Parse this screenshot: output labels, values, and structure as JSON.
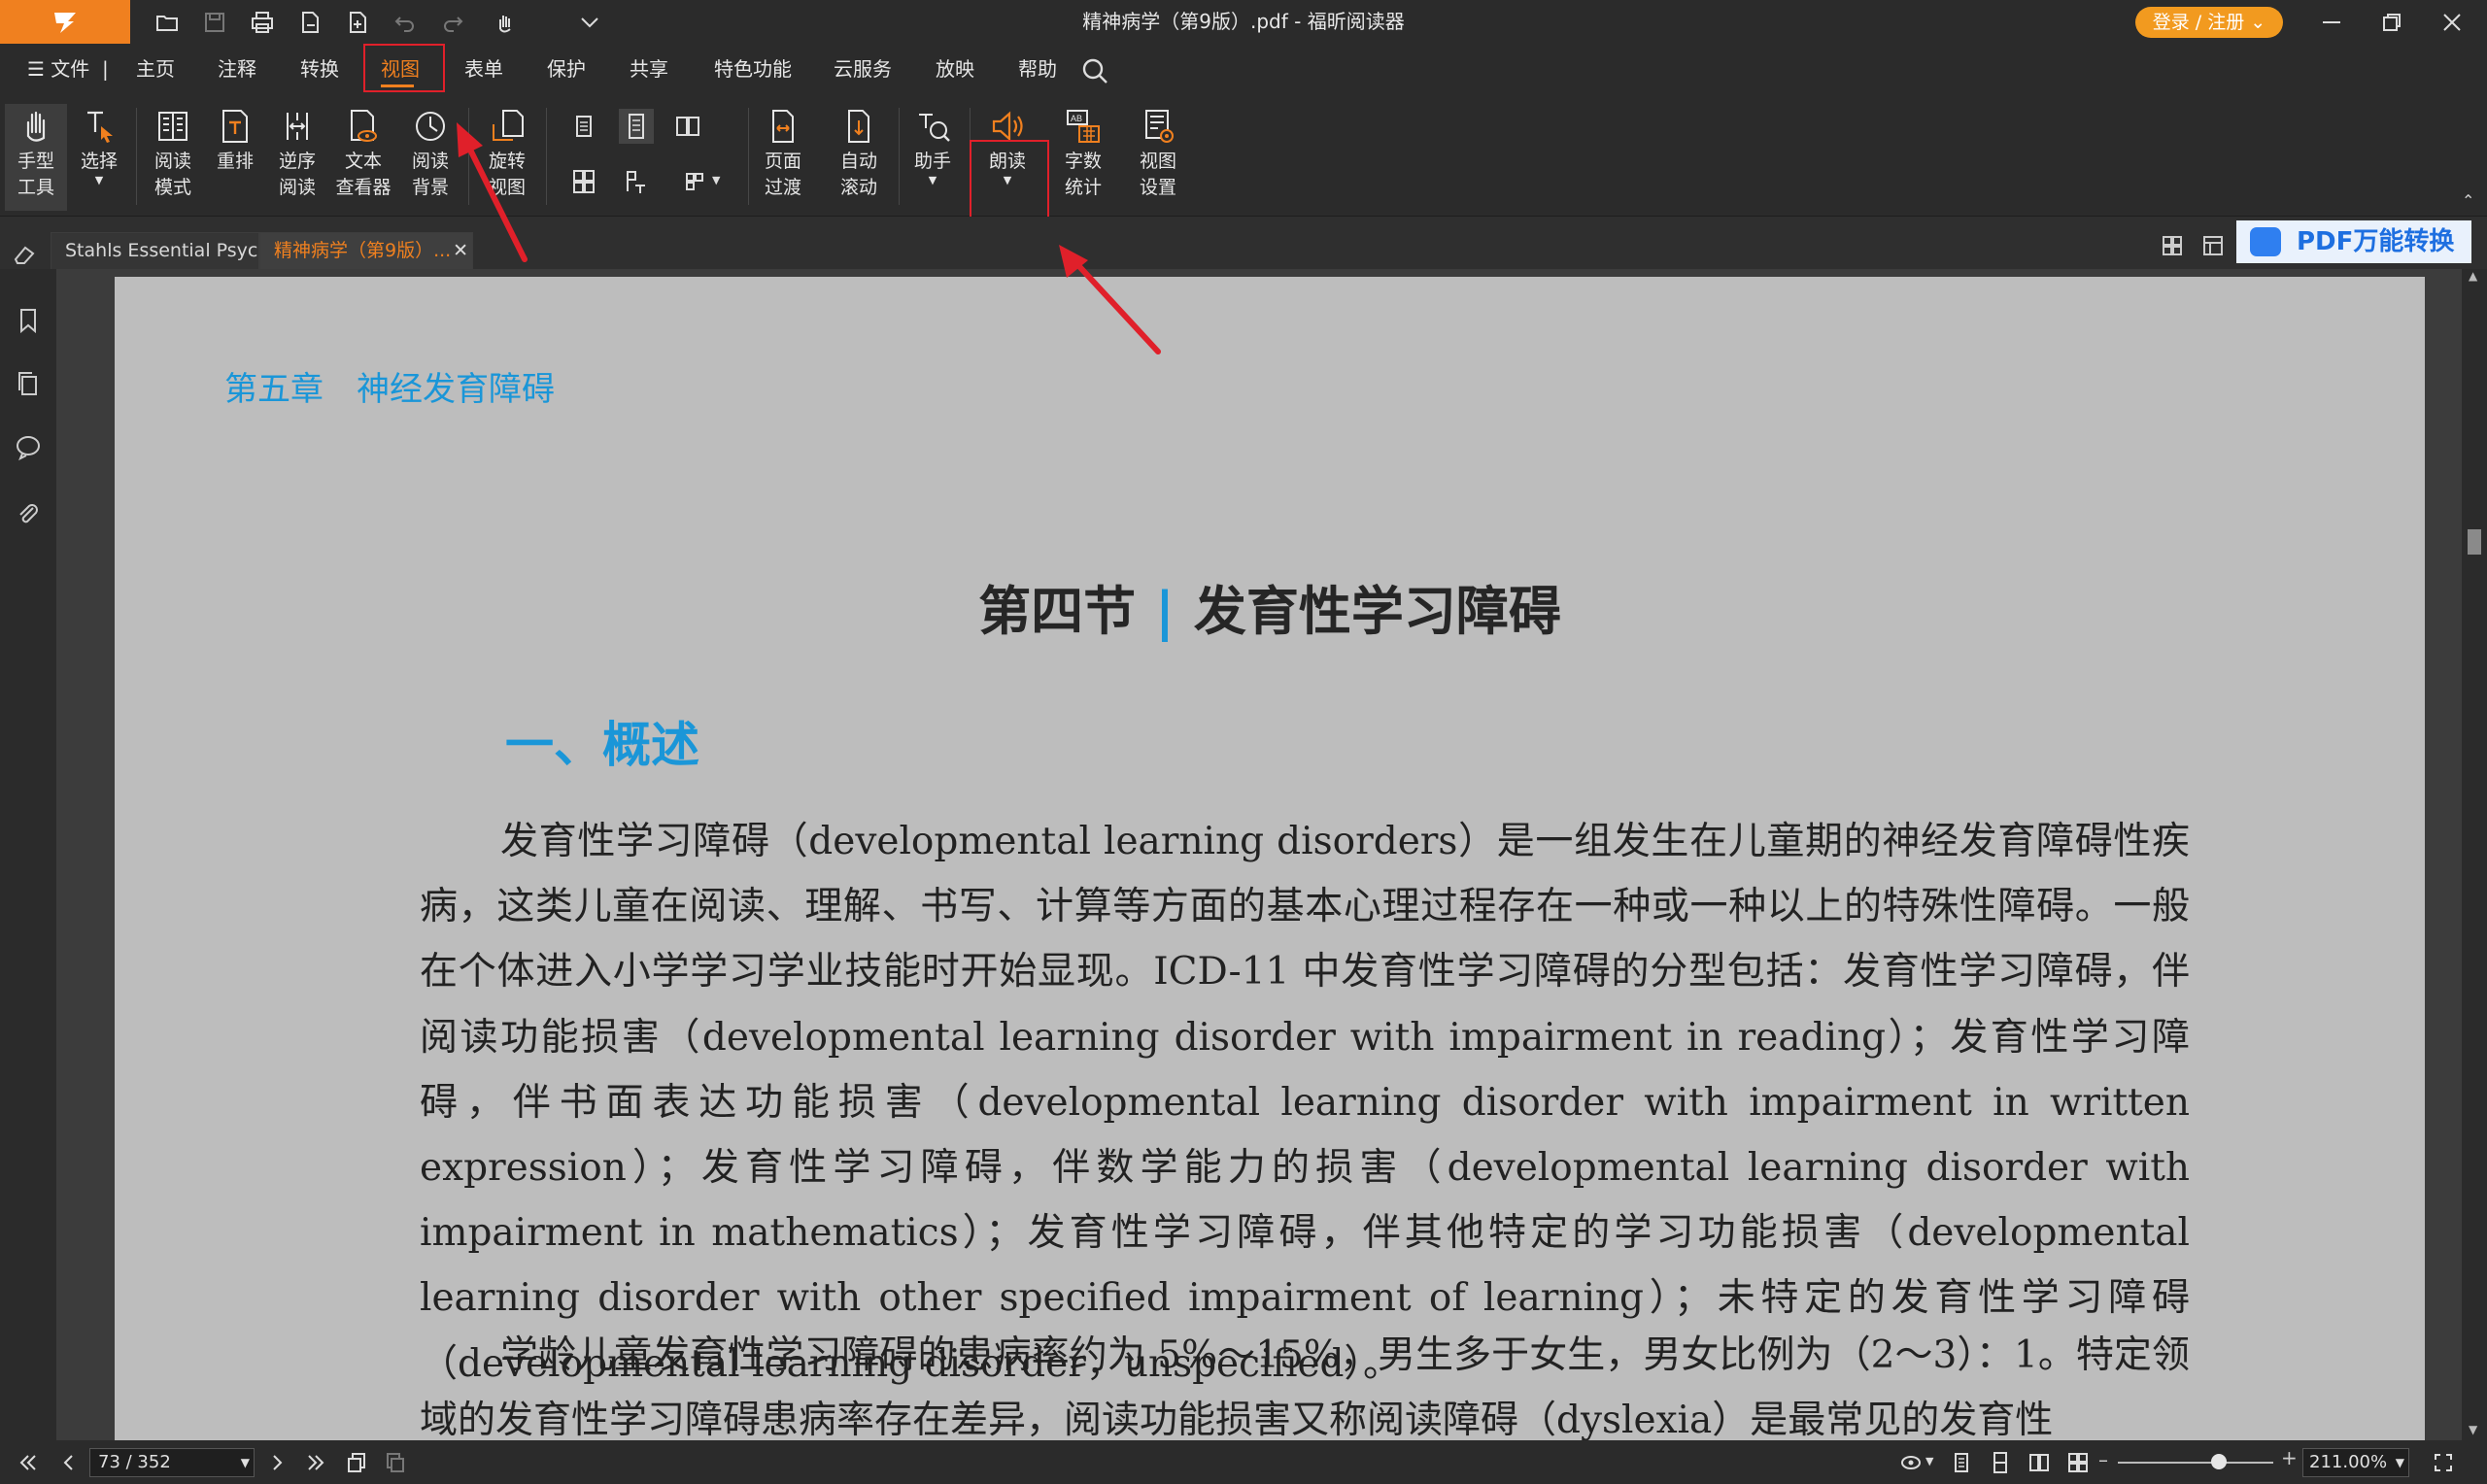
{
  "window": {
    "title": "精神病学（第9版）.pdf - 福昕阅读器",
    "login_label": "登录 / 注册"
  },
  "menu": {
    "file": "文件",
    "tabs": [
      "主页",
      "注释",
      "转换",
      "视图",
      "表单",
      "保护",
      "共享",
      "特色功能",
      "云服务",
      "放映",
      "帮助"
    ],
    "active_tab": "视图"
  },
  "ribbon": {
    "hand_tool": "手型\n工具",
    "select": "选择",
    "read_mode": "阅读\n模式",
    "reflow": "重排",
    "reverse_read": "逆序\n阅读",
    "text_viewer": "文本\n查看器",
    "read_background": "阅读\n背景",
    "rotate_view": "旋转\n视图",
    "page_transition": "页面\n过渡",
    "auto_scroll": "自动\n滚动",
    "assistant": "助手",
    "read_aloud": "朗读",
    "word_count": "字数\n统计",
    "view_settings": "视图\n设置"
  },
  "doc_tabs": [
    {
      "label": "Stahls Essential Psycho...",
      "active": false
    },
    {
      "label": "精神病学（第9版）...",
      "active": true
    }
  ],
  "pdf_convert_label": "PDF万能转换",
  "document": {
    "chapter": "第五章　神经发育障碍",
    "section_prefix": "第四节",
    "section_bar": "|",
    "section_title": "发育性学习障碍",
    "heading1": "一、概述",
    "para1": "发育性学习障碍（developmental learning disorders）是一组发生在儿童期的神经发育障碍性疾病，这类儿童在阅读、理解、书写、计算等方面的基本心理过程存在一种或一种以上的特殊性障碍。一般在个体进入小学学习学业技能时开始显现。ICD-11 中发育性学习障碍的分型包括：发育性学习障碍，伴阅读功能损害（developmental learning disorder with impairment in reading）；发育性学习障碍，伴书面表达功能损害（developmental learning disorder with impairment in written expression）；发育性学习障碍，伴数学能力的损害（developmental learning disorder with impairment in mathematics）；发育性学习障碍，伴其他特定的学习功能损害（developmental learning disorder with other specified impairment of learning）；未特定的发育性学习障碍（developmental learning disorder，unspecified）。",
    "para2": "学龄儿童发育性学习障碍的患病率约为 5%～15%，男生多于女生，男女比例为（2～3）：1。特定领域的发育性学习障碍患病率存在差异，阅读功能损害又称阅读障碍（dyslexia）是最常见的发育性"
  },
  "status": {
    "page": "73 / 352",
    "zoom": "211.00%",
    "zoom_level": 0.65
  },
  "colors": {
    "accent": "#f0801f",
    "highlight_box": "#e0202a",
    "chapter_blue": "#1a96d8"
  }
}
